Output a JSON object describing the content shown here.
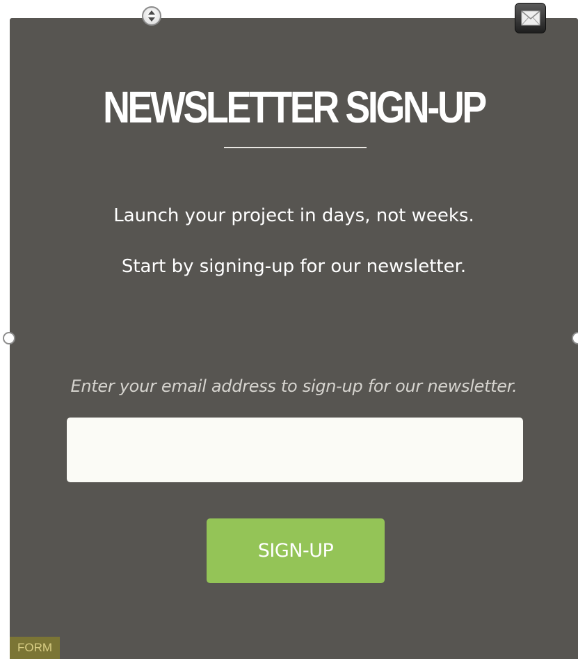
{
  "newsletter": {
    "title": "NEWSLETTER SIGN-UP",
    "tagline_1": "Launch your project in days, not weeks.",
    "tagline_2": "Start by signing-up for our newsletter.",
    "email_label": "Enter your email address to sign-up for our newsletter.",
    "email_value": "",
    "email_placeholder": "",
    "button_label": "SIGN-UP"
  },
  "editor": {
    "block_type": "FORM",
    "top_handle_icon": "move-handle-icon",
    "side_handle_icon": "resize-handle-icon",
    "corner_icon": "envelope-icon"
  },
  "colors": {
    "panel_background": "#575551",
    "accent": "#94c457",
    "input_background": "#fbfbf6",
    "text": "#ffffff"
  }
}
